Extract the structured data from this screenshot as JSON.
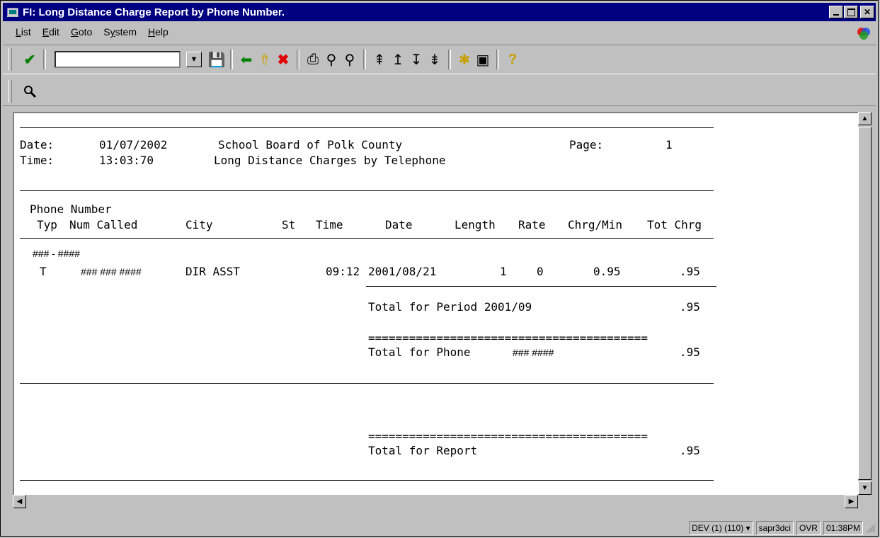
{
  "window": {
    "title": "FI: Long Distance Charge Report by Phone Number."
  },
  "menu": [
    "List",
    "Edit",
    "Goto",
    "System",
    "Help"
  ],
  "menu_underline": [
    "L",
    "E",
    "G",
    "y",
    "H"
  ],
  "report": {
    "date_label": "Date:",
    "date_value": "01/07/2002",
    "time_label": "Time:",
    "time_value": "13:03:70",
    "org": "School Board of Polk County",
    "subtitle": "Long Distance Charges by Telephone",
    "page_label": "Page:",
    "page_value": "1",
    "header_line1": "Phone Number",
    "columns": [
      "Typ",
      "Num Called",
      "City",
      "St",
      "Time",
      "Date",
      "Length",
      "Rate",
      "Chrg/Min",
      "Tot Chrg"
    ],
    "phone_group": "### - ####",
    "row": {
      "typ": "T",
      "num_called": "### ### ####",
      "city": "DIR ASST",
      "st": "",
      "time": "09:12",
      "date": "2001/08/21",
      "length": "1",
      "rate": "0",
      "chrg_min": "0.95",
      "tot_chrg": ".95"
    },
    "period_label": "Total for Period 2001/09",
    "period_total": ".95",
    "separator": "=========================================",
    "phone_total_label": "Total for Phone",
    "phone_total_number": "### ####",
    "phone_total": ".95",
    "report_total_label": "Total for Report",
    "report_total": ".95"
  },
  "status": {
    "system": "DEV (1) (110)",
    "server": "sapr3dci",
    "mode": "OVR",
    "clock": "01:38PM"
  }
}
